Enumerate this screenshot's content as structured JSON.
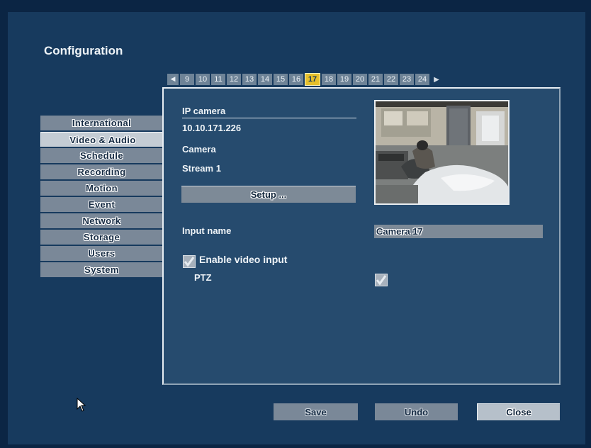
{
  "header": {
    "title": "Configuration"
  },
  "channels": {
    "prev_icon": "triangle-left-icon",
    "next_icon": "triangle-right-icon",
    "items": [
      "9",
      "10",
      "11",
      "12",
      "13",
      "14",
      "15",
      "16",
      "17",
      "18",
      "19",
      "20",
      "21",
      "22",
      "23",
      "24"
    ],
    "active": "17"
  },
  "sidebar": {
    "items": [
      {
        "label": "International"
      },
      {
        "label": "Video & Audio"
      },
      {
        "label": "Schedule"
      },
      {
        "label": "Recording"
      },
      {
        "label": "Motion"
      },
      {
        "label": "Event"
      },
      {
        "label": "Network"
      },
      {
        "label": "Storage"
      },
      {
        "label": "Users"
      },
      {
        "label": "System"
      }
    ],
    "active": "Video & Audio"
  },
  "camera": {
    "header": "IP camera",
    "ip": "10.10.171.226",
    "type": "Camera",
    "stream": "Stream 1",
    "setup_label": "Setup ..."
  },
  "form": {
    "input_name_label": "Input name",
    "input_name_value": "Camera 17",
    "enable_label": "Enable video input",
    "enable_checked": true,
    "ptz_label": "PTZ",
    "ptz_checked": true
  },
  "buttons": {
    "save": "Save",
    "undo": "Undo",
    "close": "Close"
  },
  "colors": {
    "background": "#173a5e",
    "panel": "#264b6e",
    "active_channel": "#e6c02c",
    "menu_item": "#7a8898"
  }
}
